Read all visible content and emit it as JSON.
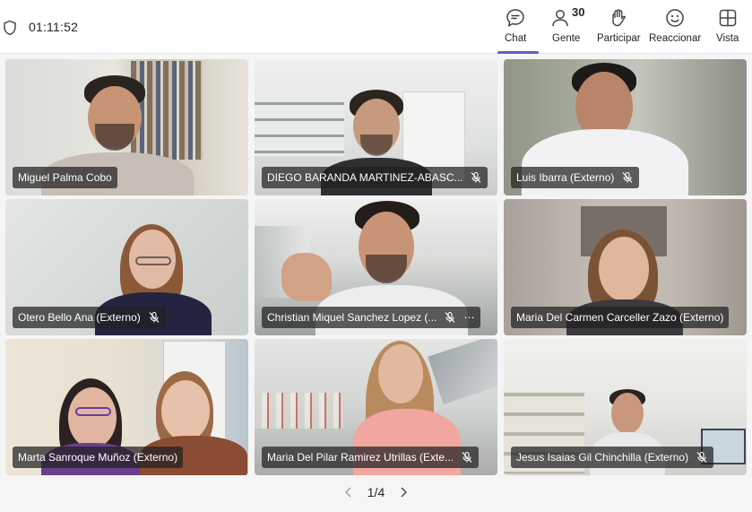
{
  "header": {
    "timer": "01:11:52",
    "buttons": {
      "chat": "Chat",
      "people": "Gente",
      "people_count": "30",
      "participate": "Participar",
      "react": "Reaccionar",
      "view": "Vista"
    }
  },
  "tiles": [
    {
      "name": "Miguel Palma Cobo"
    },
    {
      "name": "DIEGO BARANDA MARTINEZ-ABASC..."
    },
    {
      "name": "Luis Ibarra (Externo)"
    },
    {
      "name": "Otero Bello Ana (Externo)"
    },
    {
      "name": "Christian Miquel Sanchez Lopez (..."
    },
    {
      "name": "Maria Del Carmen Carceller Zazo (Externo)"
    },
    {
      "name": "Marta Sanroque Muñoz (Externo)"
    },
    {
      "name": "Maria Del Pilar Ramirez Utrillas (Exte..."
    },
    {
      "name": "Jesus Isaias Gil Chinchilla (Externo)"
    }
  ],
  "pager": {
    "label": "1/4"
  },
  "colors": {
    "accent": "#5b5fc7",
    "tag_bg": "#202020"
  }
}
